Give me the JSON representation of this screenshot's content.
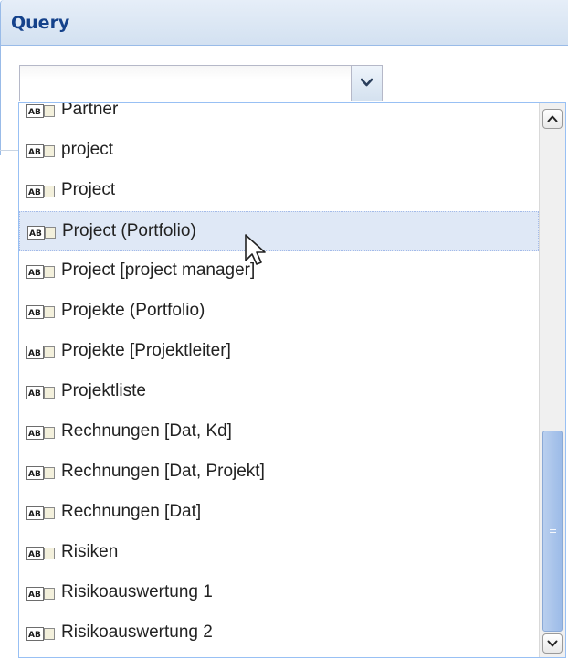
{
  "panel": {
    "title": "Query"
  },
  "combo": {
    "value": "",
    "trigger_icon": "chevron-down-icon"
  },
  "dropdown": {
    "item_icon": "text-field-icon",
    "selected_index": 3,
    "items": [
      {
        "label": "Partner"
      },
      {
        "label": "project"
      },
      {
        "label": "Project"
      },
      {
        "label": "Project (Portfolio)"
      },
      {
        "label": "Project [project manager]"
      },
      {
        "label": "Projekte (Portfolio)"
      },
      {
        "label": "Projekte [Projektleiter]"
      },
      {
        "label": "Projektliste"
      },
      {
        "label": "Rechnungen [Dat, Kd]"
      },
      {
        "label": "Rechnungen [Dat, Projekt]"
      },
      {
        "label": "Rechnungen [Dat]"
      },
      {
        "label": "Risiken"
      },
      {
        "label": "Risikoauswertung 1"
      },
      {
        "label": "Risikoauswertung 2"
      }
    ]
  },
  "colors": {
    "panel_title": "#15428b",
    "selection": "#dfe8f6",
    "scroll_thumb": "#9cbbe8"
  }
}
